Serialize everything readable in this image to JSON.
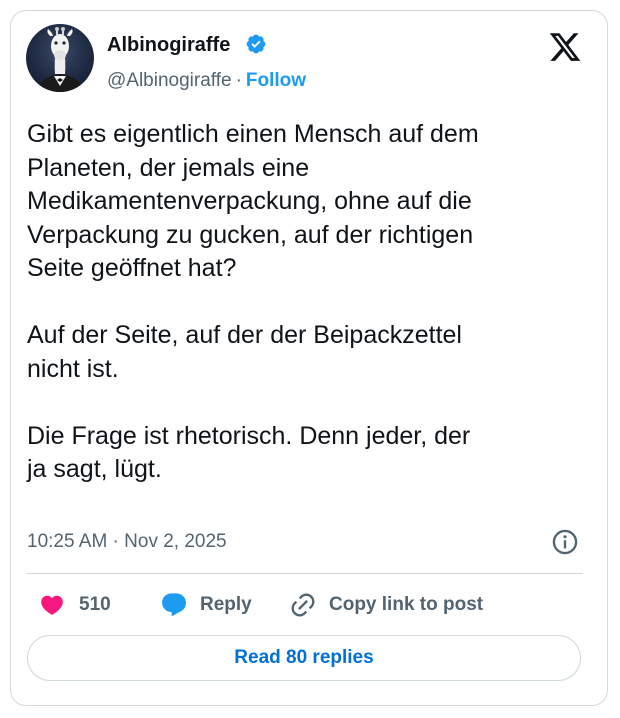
{
  "author": {
    "name": "Albinogiraffe",
    "handle": "@Albinogiraffe",
    "separator": "·",
    "follow_label": "Follow"
  },
  "tweet": {
    "text": "Gibt es eigentlich einen Mensch auf dem\nPlaneten, der jemals eine\nMedikamentenverpackung, ohne auf die\nVerpackung zu gucken, auf der richtigen\nSeite geöffnet hat?\n\nAuf der Seite, auf der der Beipackzettel\nnicht ist.\n\nDie Frage ist rhetorisch. Denn jeder, der\nja sagt, lügt.",
    "timestamp": "10:25 AM · Nov 2, 2025"
  },
  "actions": {
    "like_count": "510",
    "reply_label": "Reply",
    "copy_label": "Copy link to post"
  },
  "footer": {
    "read_replies_label": "Read 80 replies"
  },
  "icons": {
    "verified": "verified-badge-icon",
    "platform": "x-logo-icon",
    "info": "info-icon",
    "like": "heart-icon",
    "reply": "speech-bubble-icon",
    "copy": "link-icon"
  },
  "colors": {
    "accent": "#1d9bf0",
    "link_button": "#006fd6",
    "like": "#f91880",
    "text": "#0f1419",
    "muted": "#536471",
    "border": "#cfd9de"
  }
}
